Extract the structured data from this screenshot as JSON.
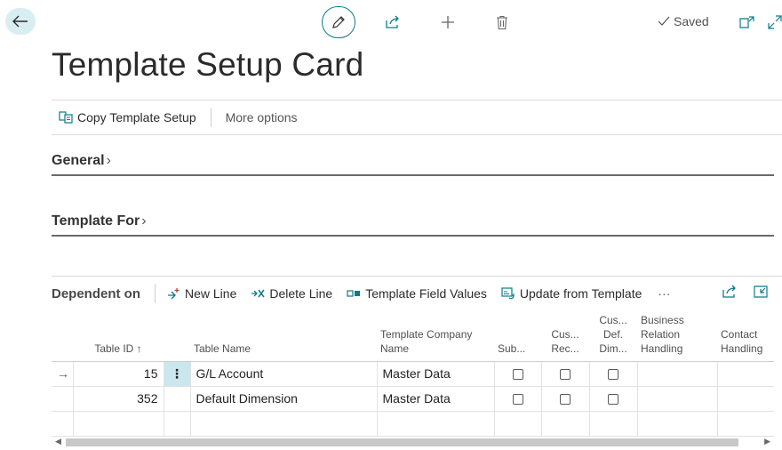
{
  "header": {
    "saved_label": "Saved"
  },
  "page": {
    "title": "Template Setup Card"
  },
  "actions": {
    "copy_template_setup": "Copy Template Setup",
    "more_options": "More options"
  },
  "fasttabs": {
    "general": "General",
    "template_for": "Template For"
  },
  "subpage": {
    "title": "Dependent on",
    "new_line": "New Line",
    "delete_line": "Delete Line",
    "template_field_values": "Template Field Values",
    "update_from_template": "Update from Template",
    "ellipsis": "···"
  },
  "table": {
    "columns": {
      "table_id": "Table ID ↑",
      "table_name": "Table Name",
      "template_company_line1": "Template Company",
      "template_company_line2": "Name",
      "sub": "Sub...",
      "cus_rec_line1": "Cus...",
      "cus_rec_line2": "Rec...",
      "cus_def_line1": "Cus...",
      "cus_def_line2": "Def.",
      "cus_def_line3": "Dim...",
      "brh_line1": "Business",
      "brh_line2": "Relation",
      "brh_line3": "Handling",
      "contact_line1": "Contact",
      "contact_line2": "Handling"
    },
    "rows": [
      {
        "table_id": "15",
        "table_name": "G/L Account",
        "company": "Master Data",
        "row_marker": "→",
        "menu": "⋮"
      },
      {
        "table_id": "352",
        "table_name": "Default Dimension",
        "company": "Master Data",
        "row_marker": "",
        "menu": ""
      }
    ]
  },
  "colors": {
    "accent": "#0b7b8c",
    "back_button_bg": "#d9eef3",
    "selected_cell_bg": "#c9e7ec"
  }
}
